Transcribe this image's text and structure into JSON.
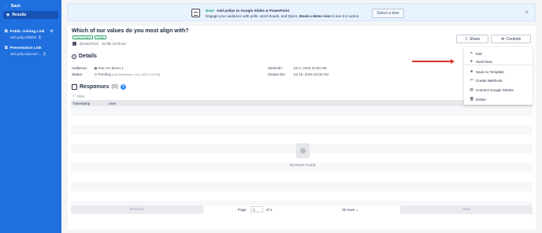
{
  "sidebar": {
    "back_label": "Back",
    "results_label": "Results",
    "links": [
      {
        "title": "Public Joining Link",
        "url": "web.polly.ai/fk8h6"
      },
      {
        "title": "Presentation Link",
        "url": "web.polly.ai/presen..."
      }
    ]
  },
  "banner": {
    "new_label": "New!",
    "headline": "Add pollys to Google Slides & PowerPoint",
    "text_prefix": "Engage your audience with polls, word clouds, and Q&As.",
    "text_bold": "Book a demo now",
    "text_suffix": "to see it in action.",
    "button_label": "Select a time",
    "close_glyph": "×"
  },
  "polly": {
    "title": "Which of our values do you most align with?",
    "tags": [
      "Open Ended",
      "Public"
    ],
    "author": "@Asad Rizvi",
    "date": "Jul 9th 10:00 am"
  },
  "actions": {
    "share_label": "Share",
    "controls_label": "Controls"
  },
  "details": {
    "heading": "Details",
    "audience_label": "Audience:",
    "audience_value": "#arr-vm-demo-1",
    "status_label": "Status:",
    "status_value": "Pending",
    "status_note": "(Last Refreshed: Jul 8, 2025 2:14 PM)",
    "send_on_label": "Send On:",
    "send_on_value": "Jul 9, 2025 10:00 AM",
    "closes_on_label": "Closes On:",
    "closes_on_value": "Jul 16, 2025 10:00 AM"
  },
  "responses": {
    "heading": "Responses",
    "count": "(0)",
    "filter_label": "Filter",
    "columns": [
      "Timestamp",
      "User"
    ],
    "empty_label": "No Rows Found"
  },
  "pagination": {
    "previous_label": "Previous",
    "page_label": "Page",
    "page_value": "1",
    "of_label": "of 1",
    "rows_label": "25 rows",
    "next_label": "Next"
  },
  "controls_menu": {
    "items": [
      {
        "label": "Edit",
        "icon": "pencil-icon"
      },
      {
        "label": "Send Now",
        "icon": "send-icon"
      },
      {
        "label": "Save As Template",
        "icon": "template-icon"
      },
      {
        "label": "Create Webhook",
        "icon": "webhook-icon"
      },
      {
        "label": "Connect Google Sheets",
        "icon": "sheets-icon"
      },
      {
        "label": "Delete",
        "icon": "trash-icon"
      }
    ]
  },
  "colors": {
    "sidebar": "#1f6fde",
    "accent": "#2f8af5",
    "annotation_arrow": "#d9352b"
  }
}
